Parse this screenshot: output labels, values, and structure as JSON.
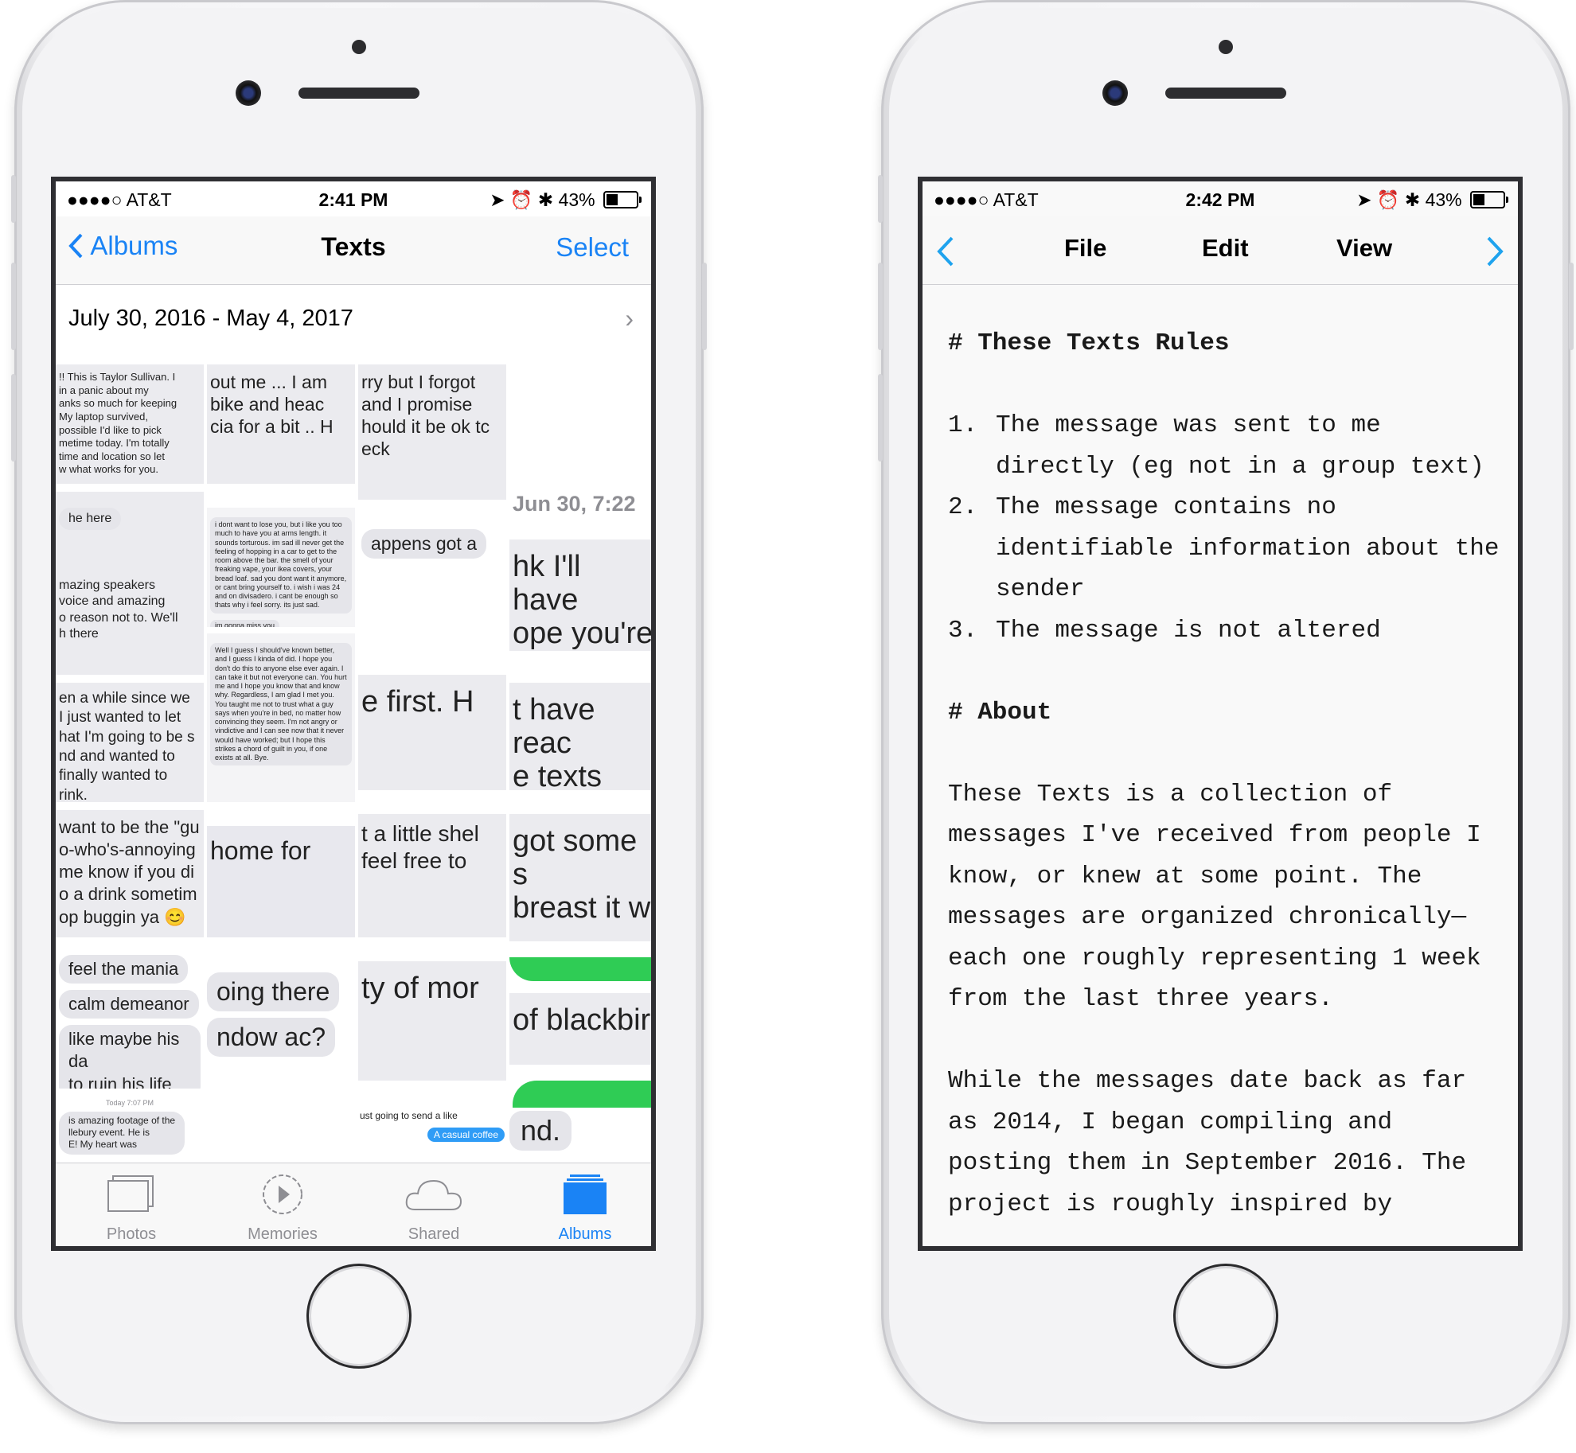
{
  "left_phone": {
    "status": {
      "carrier": "●●●●○ AT&T",
      "time": "2:41 PM",
      "battery": "43%",
      "battery_level": 0.43
    },
    "nav": {
      "back_label": "Albums",
      "title": "Texts",
      "action": "Select"
    },
    "date_range": "July 30, 2016 - May 4, 2017",
    "tiles": [
      "!! This is Taylor Sullivan. I\n in a panic about my\nanks so much for keeping\nMy laptop survived,\n possible I'd like to pick\nmetime today. I'm totally\n time and location so let\nw what works for you.",
      "out me ... I am\n bike and heac\ncia for a bit .. H",
      "rry but I forgot\n and I promise\nhould it be ok tc\neck",
      "Jun 30, 7:22",
      "he here",
      "mazing speakers\nvoice and amazing\no reason not to. We'll\nh there",
      "i dont want to lose you, but i like you too much to have you at arms length. it sounds torturous. im sad ill never get the feeling of hopping in a car to get to the room above the bar. the smell of your freaking vape, your ikea covers, your bread loaf. sad you dont want it anymore, or cant bring yourself to. i wish i was 24 and on divisadero. i cant be enough so thats why i feel sorry. its just sad.",
      "im gonna miss you",
      "appens got a",
      "hk I'll have\nope you're",
      "en a while since we\n I just wanted to let\nhat I'm going to be s\nnd and wanted to\n finally wanted to\nrink.",
      "Well I guess I should've known better, and I guess I kinda of did. I hope you don't do this to anyone else ever again. I can take it but not everyone can. You hurt me and I hope you know that and know why. Regardless, I am glad I met you. You taught me not to trust what a guy says when you're in bed, no matter how convincing they seem. I'm not angry or vindictive and I can see now that it never would have worked; but I hope this strikes a chord of guilt in you, if one exists at all. Bye.",
      "e first.  H",
      "t have reac\ne texts",
      "want to be the \"gu\no-who's-annoying\nme know if you di\no a drink sometim\nop buggin ya 😊",
      "home for",
      "t a little shel\n feel free to",
      "got some s\n breast it w",
      "feel the mania",
      "calm demeanor",
      " like maybe his da\n to ruin his life",
      "oing there",
      "ndow ac?",
      "ty of mor",
      "of blackbir",
      "Today 7:07 PM",
      "is amazing footage of the\nllebury event. He is\nE! My heart was",
      "ust going to send a like",
      "A casual coffee",
      "nd."
    ],
    "tabs": [
      {
        "label": "Photos",
        "active": false
      },
      {
        "label": "Memories",
        "active": false
      },
      {
        "label": "Shared",
        "active": false
      },
      {
        "label": "Albums",
        "active": true
      }
    ]
  },
  "right_phone": {
    "status": {
      "carrier": "●●●●○ AT&T",
      "time": "2:42 PM",
      "battery": "43%",
      "battery_level": 0.43
    },
    "menu": {
      "file": "File",
      "edit": "Edit",
      "view": "View"
    },
    "doc": {
      "heading1": "# These Texts Rules",
      "rules": [
        {
          "num": "1.",
          "text": "The message was sent to me directly (eg not in a group text)"
        },
        {
          "num": "2.",
          "text": "The message contains no identifiable information about the sender"
        },
        {
          "num": "3.",
          "text": "The message is not altered"
        }
      ],
      "heading2": "# About",
      "para1": "These Texts is a collection of messages I've received from people I know, or knew at some point. The messages are organized chronically— each one roughly representing 1 week from the last three years.",
      "para2": "While the messages date back as far as 2014, I began compiling and posting them in September 2016. The project is roughly inspired by"
    }
  }
}
